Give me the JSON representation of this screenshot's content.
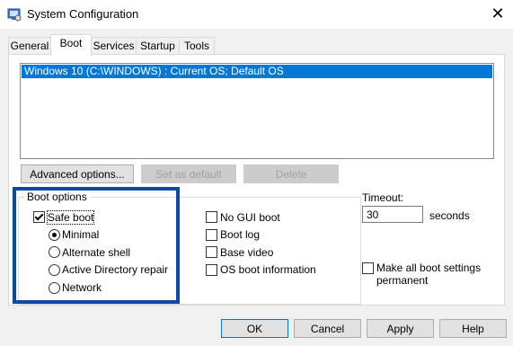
{
  "window": {
    "title": "System Configuration",
    "close_glyph": "✕"
  },
  "tabs": [
    {
      "label": "General"
    },
    {
      "label": "Boot"
    },
    {
      "label": "Services"
    },
    {
      "label": "Startup"
    },
    {
      "label": "Tools"
    }
  ],
  "boot_list": {
    "items": [
      "Windows 10 (C:\\WINDOWS) : Current OS; Default OS"
    ]
  },
  "buttons": {
    "advanced": "Advanced options...",
    "set_default": "Set as default",
    "delete": "Delete",
    "ok": "OK",
    "cancel": "Cancel",
    "apply": "Apply",
    "help": "Help"
  },
  "boot_options": {
    "legend": "Boot options",
    "safe_boot": {
      "label": "Safe boot",
      "checked": true
    },
    "minimal": {
      "label": "Minimal",
      "selected": true
    },
    "alternate_shell": {
      "label": "Alternate shell"
    },
    "ad_repair": {
      "label": "Active Directory repair"
    },
    "network": {
      "label": "Network"
    },
    "no_gui": {
      "label": "No GUI boot",
      "checked": false
    },
    "boot_log": {
      "label": "Boot log",
      "checked": false
    },
    "base_video": {
      "label": "Base video",
      "checked": false
    },
    "os_info": {
      "label": "OS boot information",
      "checked": false
    }
  },
  "timeout": {
    "label": "Timeout:",
    "value": "30",
    "unit": "seconds"
  },
  "make_permanent": {
    "label_line1": "Make all boot settings",
    "label_line2": "permanent",
    "checked": false
  },
  "colors": {
    "selection": "#0078d7",
    "highlight_frame": "#0a4aa2"
  }
}
